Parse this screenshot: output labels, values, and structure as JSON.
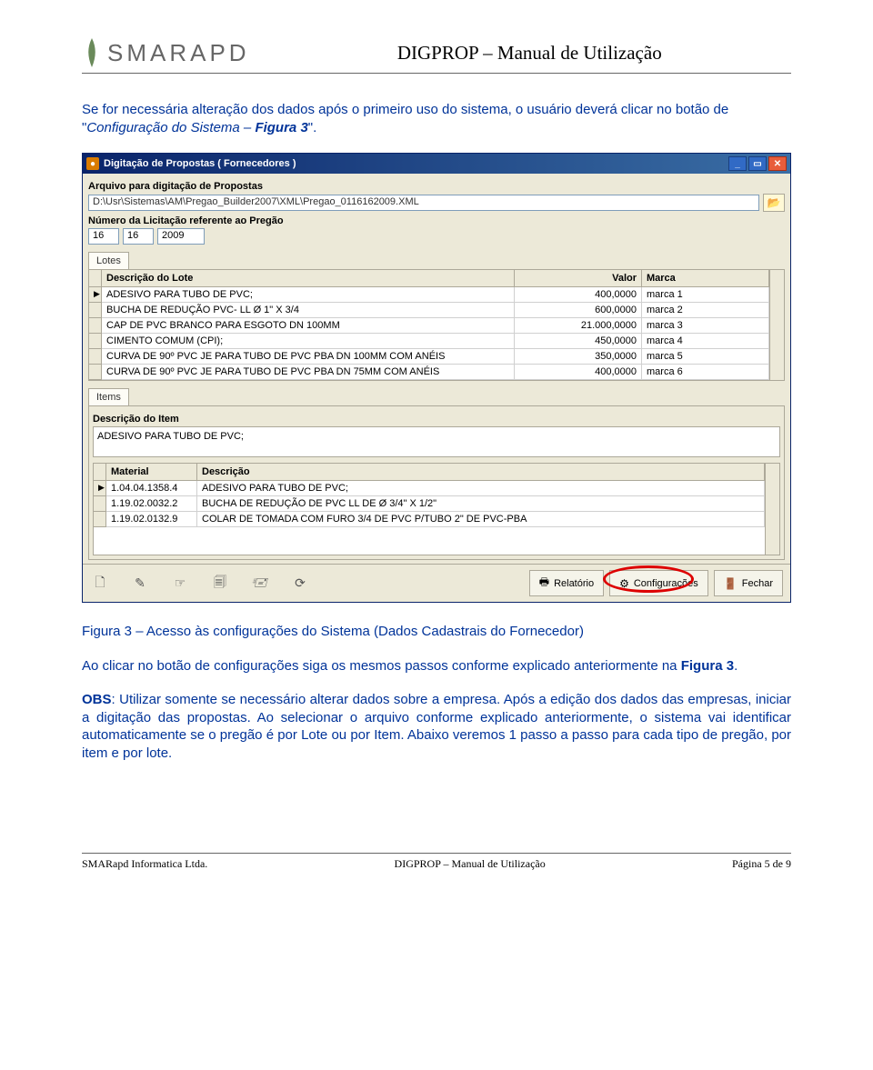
{
  "header": {
    "logo_text": "SMARAPD",
    "doc_title": "DIGPROP – Manual de Utilização"
  },
  "body": {
    "p1_a": "Se for necessária alteração dos dados após o primeiro uso do sistema, o usuário deverá clicar no botão de \"",
    "p1_b": "Configuração do Sistema – ",
    "p1_c": "Figura 3",
    "p1_d": "\".",
    "caption": "Figura 3 – Acesso às configurações do Sistema (Dados Cadastrais do Fornecedor)",
    "p2_a": "Ao clicar no botão de configurações siga os mesmos passos conforme explicado anteriormente na ",
    "p2_b": "Figura 3",
    "p2_c": ".",
    "p3_a": "OBS",
    "p3_b": ": Utilizar somente se necessário alterar dados sobre a empresa. Após a edição dos dados das empresas, iniciar a digitação das propostas. Ao selecionar o arquivo conforme explicado anteriormente, o sistema vai identificar automaticamente se o pregão é por Lote ou por Item. Abaixo veremos 1 passo a passo para cada tipo de pregão, por item e por lote."
  },
  "screenshot": {
    "title": "Digitação de Propostas ( Fornecedores )",
    "lbl_arquivo": "Arquivo para digitação de Propostas",
    "file_path": "D:\\Usr\\Sistemas\\AM\\Pregao_Builder2007\\XML\\Pregao_0116162009.XML",
    "lbl_numero": "Número da Licitação referente ao Pregão",
    "num1": "16",
    "num2": "16",
    "num3": "2009",
    "tab_lotes": "Lotes",
    "lotes_headers": {
      "desc": "Descrição do Lote",
      "valor": "Valor",
      "marca": "Marca"
    },
    "lotes_rows": [
      {
        "ind": "▶",
        "desc": "ADESIVO PARA TUBO DE PVC;",
        "valor": "400,0000",
        "marca": "marca 1"
      },
      {
        "ind": "",
        "desc": "BUCHA DE REDUÇÃO PVC- LL Ø 1\" X 3/4",
        "valor": "600,0000",
        "marca": "marca 2"
      },
      {
        "ind": "",
        "desc": "CAP DE PVC BRANCO PARA ESGOTO DN 100MM",
        "valor": "21.000,0000",
        "marca": "marca 3"
      },
      {
        "ind": "",
        "desc": "CIMENTO COMUM (CPI);",
        "valor": "450,0000",
        "marca": "marca 4"
      },
      {
        "ind": "",
        "desc": "CURVA DE 90º PVC JE PARA TUBO DE PVC PBA DN 100MM COM ANÉIS",
        "valor": "350,0000",
        "marca": "marca 5"
      },
      {
        "ind": "",
        "desc": "CURVA DE 90º PVC JE PARA TUBO DE PVC PBA DN 75MM COM ANÉIS",
        "valor": "400,0000",
        "marca": "marca 6"
      }
    ],
    "tab_items": "Items",
    "lbl_desc_item": "Descrição do Item",
    "desc_item_value": "ADESIVO PARA TUBO DE PVC;",
    "items_headers": {
      "mat": "Material",
      "desc": "Descrição"
    },
    "items_rows": [
      {
        "ind": "▶",
        "mat": "1.04.04.1358.4",
        "desc": "ADESIVO PARA TUBO DE PVC;"
      },
      {
        "ind": "",
        "mat": "1.19.02.0032.2",
        "desc": "BUCHA DE REDUÇÃO DE PVC LL DE Ø 3/4\" X 1/2\""
      },
      {
        "ind": "",
        "mat": "1.19.02.0132.9",
        "desc": "COLAR DE TOMADA COM FURO 3/4 DE PVC P/TUBO 2\" DE PVC-PBA"
      }
    ],
    "btn_relatorio": "Relatório",
    "btn_config": "Configurações",
    "btn_fechar": "Fechar"
  },
  "footer": {
    "left": "SMARapd Informatica Ltda.",
    "center": "DIGPROP – Manual de Utilização",
    "right": "Página 5 de 9"
  }
}
